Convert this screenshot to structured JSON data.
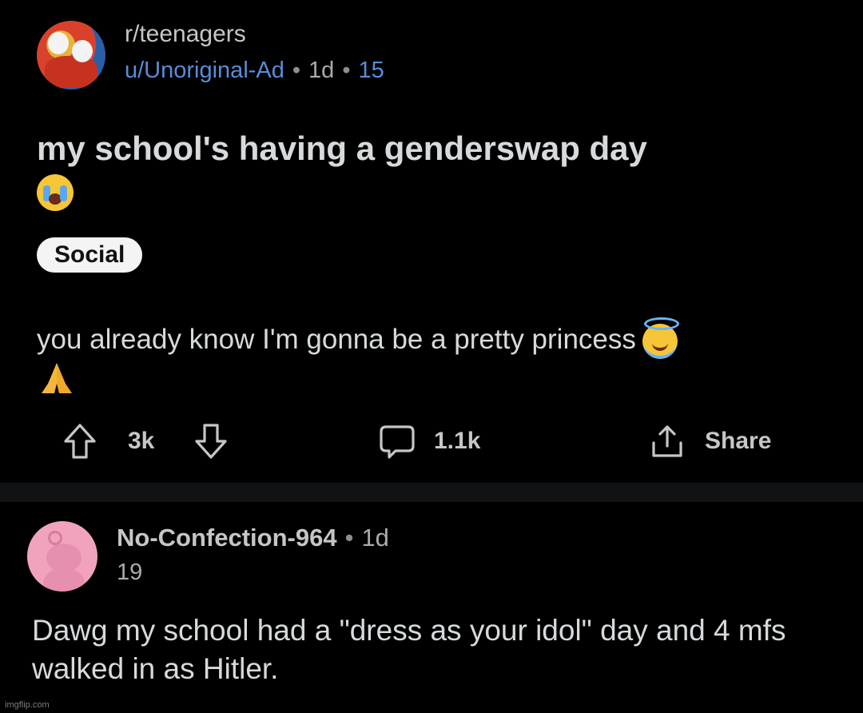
{
  "post": {
    "subreddit": "r/teenagers",
    "author": "u/Unoriginal-Ad",
    "age": "1d",
    "score_meta": "15",
    "title": "my school's having a genderswap day",
    "title_emoji": "loudly-crying-face-emoji",
    "flair": "Social",
    "body": "you already know I'm gonna be a pretty princess",
    "body_emojis": [
      "smiling-face-with-halo-emoji",
      "folded-hands-emoji"
    ]
  },
  "actions": {
    "upvote_icon": "upvote-arrow-icon",
    "votes": "3k",
    "downvote_icon": "downvote-arrow-icon",
    "comments_icon": "comment-bubble-icon",
    "comments": "1.1k",
    "share_icon": "share-icon",
    "share": "Share"
  },
  "comment": {
    "username": "No-Confection-964",
    "age": "1d",
    "score": "19",
    "text": "Dawg my school had a \"dress as your idol\" day and 4 mfs walked in as Hitler."
  },
  "watermark": "imgflip.com",
  "colors": {
    "background": "#000000",
    "author_link": "#5a8cd7",
    "flair_bg": "#f4f4f4",
    "text": "#d7dadc"
  }
}
